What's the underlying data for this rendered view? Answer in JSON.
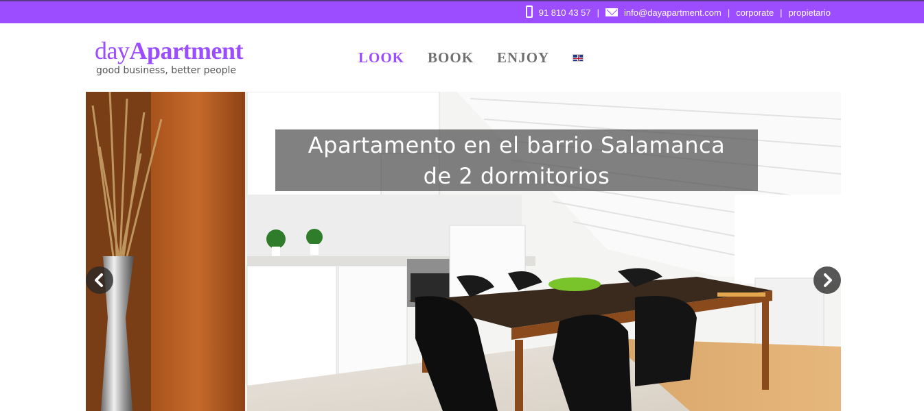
{
  "topbar": {
    "phone_icon": "phone-icon",
    "phone": "91 810 43 57",
    "mail_icon": "envelope-icon",
    "email": "info@dayapartment.com",
    "links": [
      "corporate",
      "propietario"
    ]
  },
  "logo": {
    "prefix": "day",
    "name": "Apartment",
    "tagline": "good business, better people"
  },
  "nav": {
    "items": [
      "LOOK",
      "BOOK",
      "ENJOY"
    ],
    "active": "LOOK",
    "language_icon": "uk-flag-icon"
  },
  "slider": {
    "caption_line1": "Apartamento en el barrio Salamanca",
    "caption_line2": "de 2 dormitorios",
    "prev_icon": "chevron-left-icon",
    "next_icon": "chevron-right-icon"
  },
  "colors": {
    "brand": "#9b4dff",
    "nav_text": "#707070"
  }
}
